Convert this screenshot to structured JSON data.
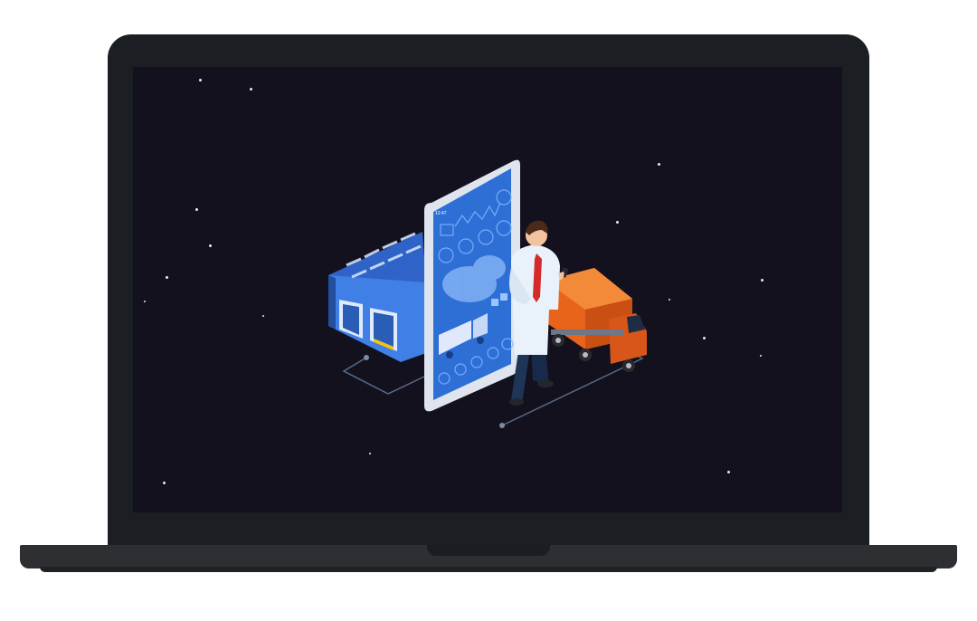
{
  "colors": {
    "lid": "#1b1e22",
    "screen_bg": "#14111f",
    "warehouse": "#3f7fe6",
    "phone_screen": "#2e6fd6",
    "truck": "#e8641b",
    "shirt": "#e9f2fb",
    "pants": "#1f3558"
  },
  "phone": {
    "status_time": "12:47"
  },
  "icons": [
    "warehouse-icon",
    "smartphone-icon",
    "delivery-truck-icon",
    "businessman-icon"
  ]
}
